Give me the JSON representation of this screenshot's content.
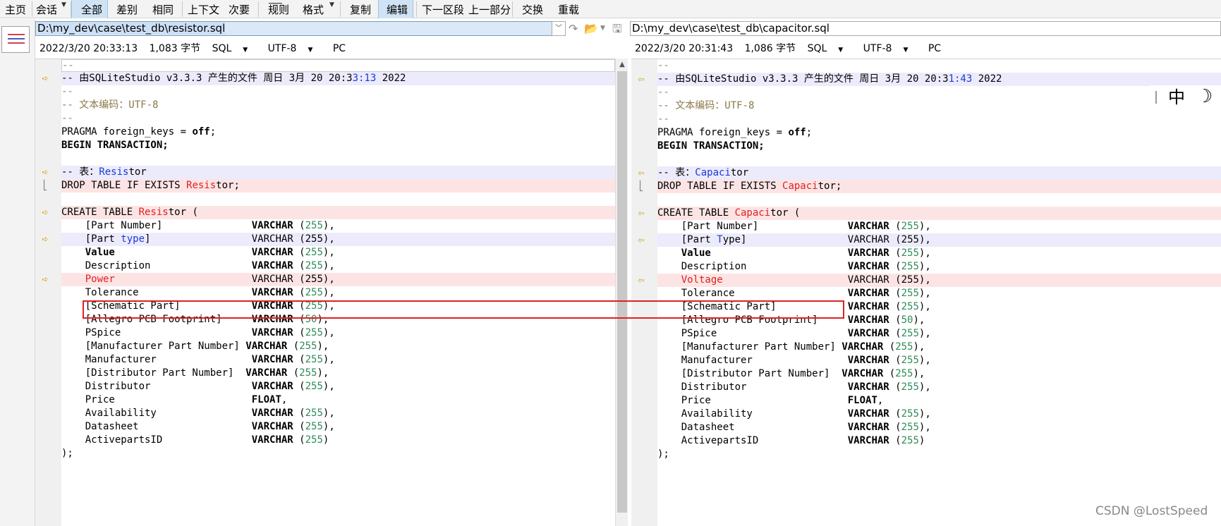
{
  "toolbar": {
    "items": [
      "主页",
      "会话",
      "全部",
      "差别",
      "相同",
      "上下文",
      "次要",
      "规则",
      "格式",
      "复制",
      "编辑",
      "下一区段",
      "上一部分",
      "交换",
      "重载"
    ]
  },
  "left": {
    "path": "D:\\my_dev\\case\\test_db\\resistor.sql",
    "timestamp": "2022/3/20 20:33:13",
    "size": "1,083 字节",
    "format": "SQL",
    "encoding": "UTF-8",
    "line_ending": "PC"
  },
  "right": {
    "path": "D:\\my_dev\\case\\test_db\\capacitor.sql",
    "timestamp": "2022/3/20 20:31:43",
    "size": "1,086 字节",
    "format": "SQL",
    "encoding": "UTF-8",
    "line_ending": "PC"
  },
  "code": {
    "dashes": "--",
    "header_prefix": "-- 由SQLiteStudio v3.3.3 产生的文件 周日 3月 20 20:3",
    "header_left_diff": "3:13",
    "header_right_diff": "1:43",
    "header_suffix": " 2022",
    "encoding_line": "-- 文本编码：UTF-8",
    "pragma_a": "PRAGMA foreign_keys = ",
    "pragma_off": "off",
    "pragma_end": ";",
    "begin": "BEGIN TRANSACTION;",
    "table_prefix": "-- 表：",
    "left_name_diff": "Resis",
    "right_name_diff": "Capaci",
    "name_tail": "tor",
    "drop_prefix": "DROP TABLE IF EXISTS ",
    "drop_suffix": "tor;",
    "create_prefix": "CREATE TABLE ",
    "create_suffix": "tor (",
    "varchar": "VARCHAR",
    "float": "FLOAT",
    "close": ");",
    "columns_left": [
      {
        "name": "    [Part Number]",
        "pad": "               ",
        "type": "VARCHAR",
        "size": "255",
        "tail": "),",
        "bold": false
      },
      {
        "name": "    [Part ",
        "diff": "type",
        "rest": "]",
        "pad": "                 ",
        "type": "VARCHAR",
        "size": "255",
        "tail": "),",
        "bold": false
      },
      {
        "name": "    Value",
        "pad": "                       ",
        "type": "VARCHAR",
        "size": "255",
        "tail": "),",
        "bold": true
      },
      {
        "name": "    Description",
        "pad": "                 ",
        "type": "VARCHAR",
        "size": "255",
        "tail": "),",
        "bold": false
      },
      {
        "name": "    Power",
        "pad": "                       ",
        "type": "VARCHAR",
        "size": "255",
        "tail": "),",
        "bold": false,
        "red": true
      },
      {
        "name": "    Tolerance",
        "pad": "                   ",
        "type": "VARCHAR",
        "size": "255",
        "tail": "),",
        "bold": false
      },
      {
        "name": "    [Schematic Part]",
        "pad": "            ",
        "type": "VARCHAR",
        "size": "255",
        "tail": "),",
        "bold": false
      },
      {
        "name": "    [Allegro PCB Footprint]",
        "pad": "     ",
        "type": "VARCHAR",
        "size": "50",
        "tail": "),",
        "bold": false
      },
      {
        "name": "    PSpice",
        "pad": "                      ",
        "type": "VARCHAR",
        "size": "255",
        "tail": "),",
        "bold": false
      },
      {
        "name": "    [Manufacturer Part Number]",
        "pad": " ",
        "type": "VARCHAR",
        "size": "255",
        "tail": "),",
        "bold": false
      },
      {
        "name": "    Manufacturer",
        "pad": "                ",
        "type": "VARCHAR",
        "size": "255",
        "tail": "),",
        "bold": false
      },
      {
        "name": "    [Distributor Part Number]",
        "pad": "  ",
        "type": "VARCHAR",
        "size": "255",
        "tail": "),",
        "bold": false
      },
      {
        "name": "    Distributor",
        "pad": "                 ",
        "type": "VARCHAR",
        "size": "255",
        "tail": "),",
        "bold": false
      },
      {
        "name": "    Price",
        "pad": "                       ",
        "type": "FLOAT",
        "size": "",
        "tail": ",",
        "bold": false
      },
      {
        "name": "    Availability",
        "pad": "                ",
        "type": "VARCHAR",
        "size": "255",
        "tail": "),",
        "bold": false
      },
      {
        "name": "    Datasheet",
        "pad": "                   ",
        "type": "VARCHAR",
        "size": "255",
        "tail": "),",
        "bold": false
      },
      {
        "name": "    ActivepartsID",
        "pad": "               ",
        "type": "VARCHAR",
        "size": "255",
        "tail": ")",
        "bold": false
      }
    ],
    "right_type_diff": "T",
    "right_type_rest": "ype",
    "right_power": "    Voltage"
  },
  "ime": {
    "lang": "中",
    "moon": "☽"
  },
  "watermark": "CSDN @LostSpeed",
  "colors": {
    "accent": "#cfe3f5",
    "diff_red_bg": "#fde4e4",
    "diff_blue_bg": "#ecebfb",
    "highlight": "#e02020"
  }
}
